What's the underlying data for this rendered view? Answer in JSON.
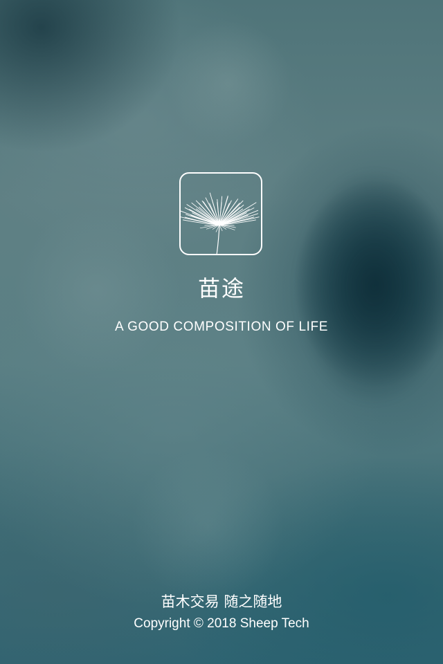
{
  "splash": {
    "logo_icon": "dandelion-icon",
    "app_name": "苗途",
    "tagline": "A GOOD COMPOSITION OF LIFE",
    "slogan": "苗木交易 随之随地",
    "copyright": "Copyright © 2018 Sheep Tech"
  },
  "colors": {
    "text": "#ffffff",
    "background_top": "#4f7479",
    "background_bottom": "#2f6472"
  }
}
